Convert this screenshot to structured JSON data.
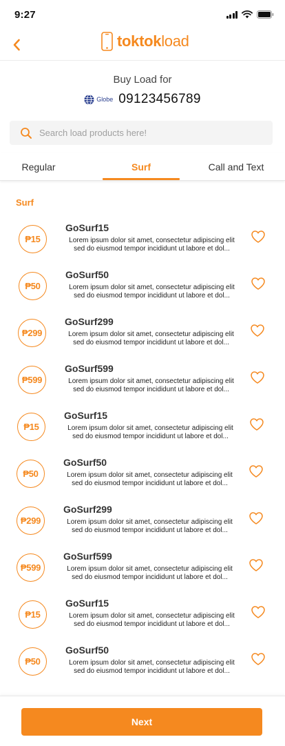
{
  "status_bar": {
    "time": "9:27"
  },
  "header": {
    "logo_text_bold": "toktok",
    "logo_text_regular": "load"
  },
  "recipient": {
    "heading": "Buy Load for",
    "network": "Globe",
    "number": "09123456789"
  },
  "search": {
    "placeholder": "Search load products here!"
  },
  "tabs": [
    {
      "label": "Regular",
      "active": false
    },
    {
      "label": "Surf",
      "active": true
    },
    {
      "label": "Call and Text",
      "active": false
    }
  ],
  "section": {
    "title": "Surf"
  },
  "products": [
    {
      "price": "₱15",
      "name": "GoSurf15",
      "desc_line1": "Lorem ipsum dolor sit amet, consectetur adipiscing elit",
      "desc_line2": "sed do eiusmod tempor incididunt ut labore et dol..."
    },
    {
      "price": "₱50",
      "name": "GoSurf50",
      "desc_line1": "Lorem ipsum dolor sit amet, consectetur adipiscing elit",
      "desc_line2": "sed do eiusmod tempor incididunt ut labore et dol..."
    },
    {
      "price": "₱299",
      "name": "GoSurf299",
      "desc_line1": "Lorem ipsum dolor sit amet, consectetur adipiscing elit",
      "desc_line2": "sed do eiusmod tempor incididunt ut labore et dol..."
    },
    {
      "price": "₱599",
      "name": "GoSurf599",
      "desc_line1": "Lorem ipsum dolor sit amet, consectetur adipiscing elit",
      "desc_line2": "sed do eiusmod tempor incididunt ut labore et dol..."
    },
    {
      "price": "₱15",
      "name": "GoSurf15",
      "desc_line1": "Lorem ipsum dolor sit amet, consectetur adipiscing elit",
      "desc_line2": "sed do eiusmod tempor incididunt ut labore et dol..."
    },
    {
      "price": "₱50",
      "name": "GoSurf50",
      "desc_line1": "Lorem ipsum dolor sit amet, consectetur adipiscing elit",
      "desc_line2": "sed do eiusmod tempor incididunt ut labore et dol..."
    },
    {
      "price": "₱299",
      "name": "GoSurf299",
      "desc_line1": "Lorem ipsum dolor sit amet, consectetur adipiscing elit",
      "desc_line2": "sed do eiusmod tempor incididunt ut labore et dol..."
    },
    {
      "price": "₱599",
      "name": "GoSurf599",
      "desc_line1": "Lorem ipsum dolor sit amet, consectetur adipiscing elit",
      "desc_line2": "sed do eiusmod tempor incididunt ut labore et dol..."
    },
    {
      "price": "₱15",
      "name": "GoSurf15",
      "desc_line1": "Lorem ipsum dolor sit amet, consectetur adipiscing elit",
      "desc_line2": "sed do eiusmod tempor incididunt ut labore et dol..."
    },
    {
      "price": "₱50",
      "name": "GoSurf50",
      "desc_line1": "Lorem ipsum dolor sit amet, consectetur adipiscing elit",
      "desc_line2": "sed do eiusmod tempor incididunt ut labore et dol..."
    }
  ],
  "footer": {
    "next_label": "Next"
  },
  "colors": {
    "accent": "#f5891f",
    "globe_blue": "#2a3f8f"
  },
  "icons": {
    "back": "chevron-left-icon",
    "logo": "phone-icon",
    "network": "globe-logo-icon",
    "search": "search-icon",
    "favorite": "heart-outline-icon"
  }
}
